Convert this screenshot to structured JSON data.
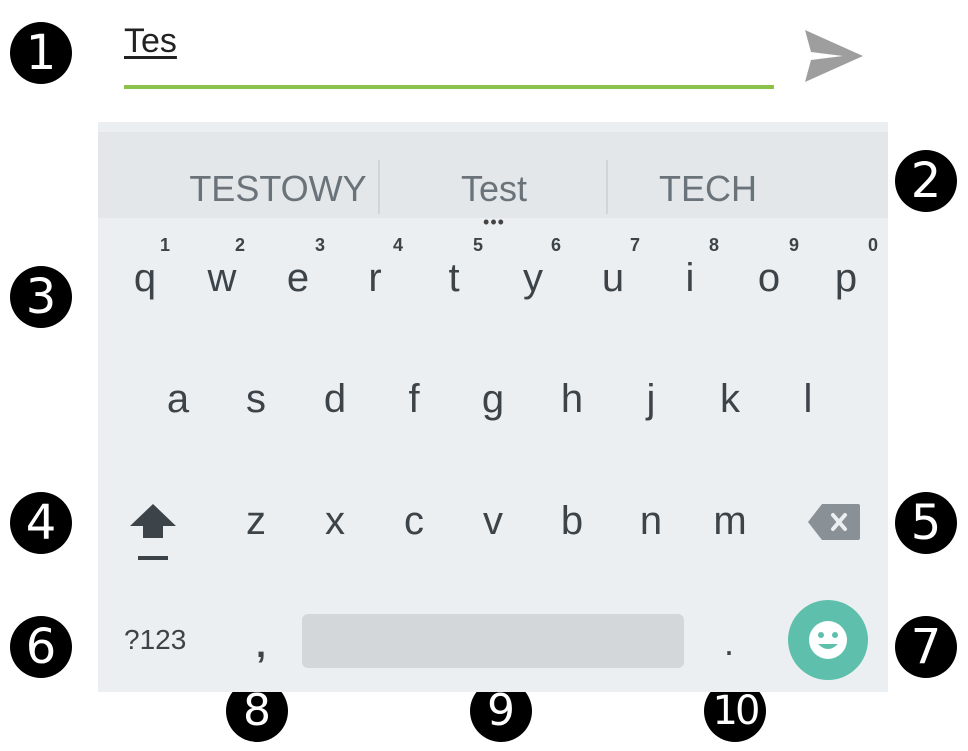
{
  "input": {
    "text": "Tes"
  },
  "suggestions": [
    "TESTOWY",
    "Test",
    "TECH"
  ],
  "suggestion_more": "•••",
  "row1": [
    {
      "letter": "q",
      "hint": "1"
    },
    {
      "letter": "w",
      "hint": "2"
    },
    {
      "letter": "e",
      "hint": "3"
    },
    {
      "letter": "r",
      "hint": "4"
    },
    {
      "letter": "t",
      "hint": "5"
    },
    {
      "letter": "y",
      "hint": "6"
    },
    {
      "letter": "u",
      "hint": "7"
    },
    {
      "letter": "i",
      "hint": "8"
    },
    {
      "letter": "o",
      "hint": "9"
    },
    {
      "letter": "p",
      "hint": "0"
    }
  ],
  "row2": [
    "a",
    "s",
    "d",
    "f",
    "g",
    "h",
    "j",
    "k",
    "l"
  ],
  "row3": [
    "z",
    "x",
    "c",
    "v",
    "b",
    "n",
    "m"
  ],
  "bottom": {
    "symbols": "?123",
    "comma": ",",
    "period": "."
  },
  "badges": [
    "1",
    "2",
    "3",
    "4",
    "5",
    "6",
    "7",
    "8",
    "9",
    "10"
  ],
  "icons": {
    "send": "send-icon",
    "shift": "shift-icon",
    "backspace": "backspace-icon",
    "emoji": "emoji-icon"
  },
  "colors": {
    "input_underline": "#8bc34a",
    "keyboard_bg": "#eceff1",
    "emoji_button": "#5ec0ac",
    "key_text": "#3c444a",
    "badge": "#000000"
  }
}
